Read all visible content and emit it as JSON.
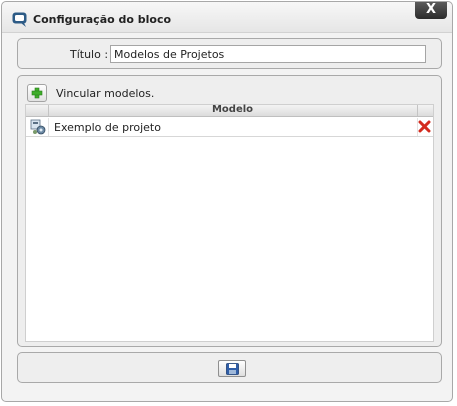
{
  "dialog": {
    "title": "Configuração do bloco",
    "close_label": "X"
  },
  "form": {
    "title_label": "Título :",
    "title_value": "Modelos de Projetos"
  },
  "models": {
    "link_label": "Vincular modelos.",
    "column_header": "Modelo",
    "rows": [
      {
        "name": "Exemplo de projeto"
      }
    ]
  },
  "icons": {
    "app": "chat-bubble-icon",
    "add": "plus-icon",
    "row": "project-model-icon",
    "delete": "red-x-icon",
    "save": "floppy-disk-icon"
  },
  "colors": {
    "close_button": "#3a3a3a",
    "add_icon": "#3fae2a",
    "delete_icon": "#d42b1e",
    "save_icon": "#2f5ea8"
  }
}
